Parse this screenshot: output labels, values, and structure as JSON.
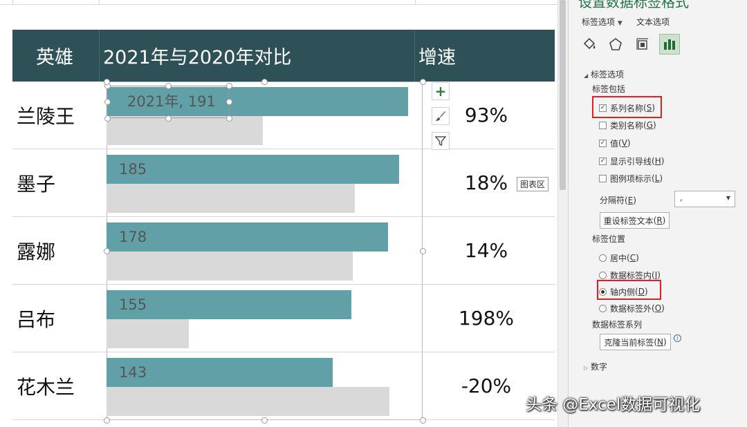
{
  "table": {
    "headers": {
      "hero": "英雄",
      "compare": "2021年与2020年对比",
      "growth": "增速"
    },
    "rows": [
      {
        "hero": "兰陵王",
        "label": "2021年, 191",
        "growth": "93%"
      },
      {
        "hero": "墨子",
        "label": "185",
        "growth": "18%"
      },
      {
        "hero": "露娜",
        "label": "178",
        "growth": "14%"
      },
      {
        "hero": "吕布",
        "label": "155",
        "growth": "198%"
      },
      {
        "hero": "花木兰",
        "label": "143",
        "growth": "-20%"
      }
    ]
  },
  "chart_data": {
    "type": "bar",
    "categories": [
      "兰陵王",
      "墨子",
      "露娜",
      "吕布",
      "花木兰"
    ],
    "series": [
      {
        "values": [
          191,
          185,
          178,
          155,
          143
        ]
      },
      {
        "values": [
          99,
          157,
          156,
          52,
          179
        ]
      }
    ],
    "xlim": [
      0,
      200
    ],
    "colors": [
      "#62a0a8",
      "#d9d9d9"
    ]
  },
  "chart_tools": {
    "icons": [
      "plus-icon",
      "brush-icon",
      "filter-icon"
    ]
  },
  "tooltip": "图表区",
  "pane": {
    "title": "设置数据标签格式",
    "tab_label_options": "标签选项",
    "tab_text_options": "文本选项",
    "section_label_options": "标签选项",
    "label_contains": "标签包括",
    "checkboxes": [
      {
        "label": "系列名称",
        "key": "S",
        "checked": true
      },
      {
        "label": "类别名称",
        "key": "G",
        "checked": false
      },
      {
        "label": "值",
        "key": "V",
        "checked": true
      },
      {
        "label": "显示引导线",
        "key": "H",
        "checked": true
      },
      {
        "label": "图例项标示",
        "key": "L",
        "checked": false
      }
    ],
    "separator_label": "分隔符",
    "separator_key": "E",
    "separator_value": ",",
    "reset_button": "重设标签文本",
    "reset_key": "R",
    "label_position": "标签位置",
    "radios": [
      {
        "label": "居中",
        "key": "C",
        "selected": false
      },
      {
        "label": "数据标签内",
        "key": "I",
        "selected": false
      },
      {
        "label": "轴内侧",
        "key": "D",
        "selected": true
      },
      {
        "label": "数据标签外",
        "key": "O",
        "selected": false
      }
    ],
    "label_series": "数据标签系列",
    "clone_button": "克隆当前标签",
    "clone_key": "N",
    "number_section": "数字"
  },
  "watermark": "头条 @Excel数据可视化"
}
